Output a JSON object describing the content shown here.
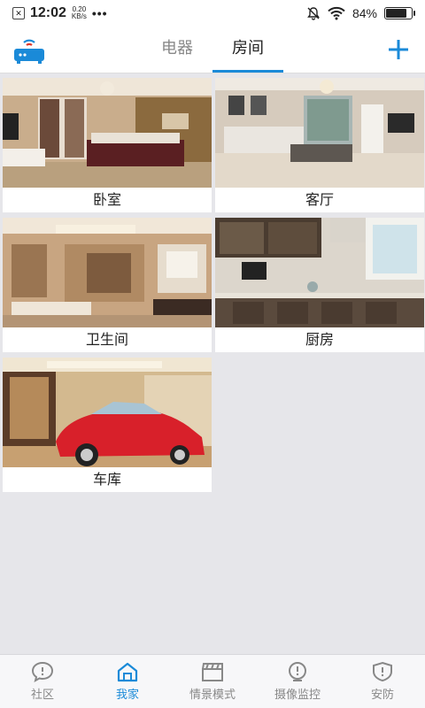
{
  "status_bar": {
    "time": "12:02",
    "speed_value": "0.20",
    "speed_unit": "KB/s",
    "dots": "•••",
    "battery": "84%",
    "battery_level": 0.84
  },
  "header": {
    "tabs": [
      {
        "label": "电器",
        "active": false
      },
      {
        "label": "房间",
        "active": true
      }
    ],
    "add_icon": "plus-icon",
    "router_icon": "router-icon"
  },
  "rooms": [
    {
      "name": "卧室",
      "scene": "bedroom"
    },
    {
      "name": "客厅",
      "scene": "living-room"
    },
    {
      "name": "卫生间",
      "scene": "bathroom"
    },
    {
      "name": "厨房",
      "scene": "kitchen"
    },
    {
      "name": "车库",
      "scene": "garage"
    }
  ],
  "bottom_nav": [
    {
      "label": "社区",
      "icon": "chat-bubble-icon",
      "active": false
    },
    {
      "label": "我家",
      "icon": "home-icon",
      "active": true
    },
    {
      "label": "情景模式",
      "icon": "clapperboard-icon",
      "active": false
    },
    {
      "label": "摄像监控",
      "icon": "camera-icon",
      "active": false
    },
    {
      "label": "安防",
      "icon": "shield-icon",
      "active": false
    }
  ],
  "colors": {
    "accent": "#1a8ad8",
    "background": "#e6e6ea",
    "inactive": "#888888"
  }
}
